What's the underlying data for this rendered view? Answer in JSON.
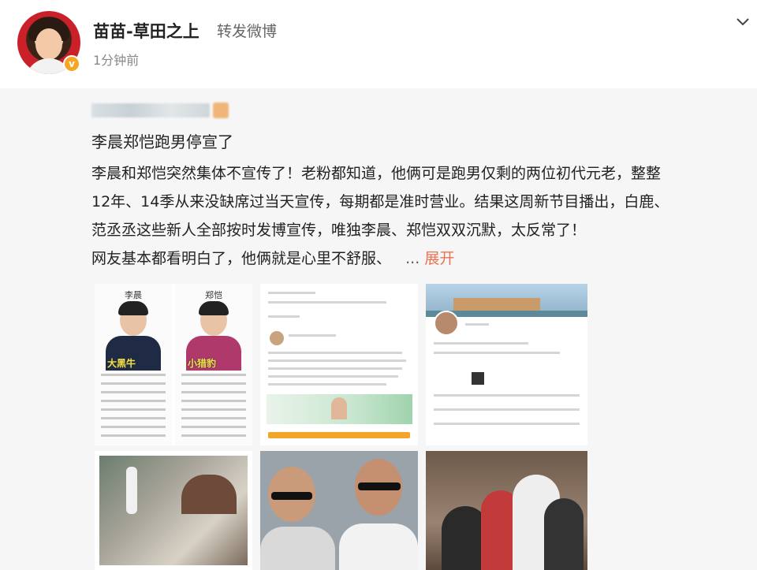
{
  "post": {
    "author_name": "苗苗-草田之上",
    "action": "转发微博",
    "time": "1分钟前"
  },
  "repost": {
    "title": "李晨郑恺跑男停宣了",
    "body_lines": [
      "李晨和郑恺突然集体不宣传了！老粉都知道，他俩可是跑男仅剩的两位初代元老，整整",
      "12年、14季从来没缺席过当天宣传，每期都是准时营业。结果这周新节目播出，白鹿、",
      "范丞丞这些新人全部按时发博宣传，唯独李晨、郑恺双双沉默，太反常了！",
      "网友基本都看明白了，他俩就是心里不舒服、"
    ],
    "ellipsis": "...",
    "expand_label": "展开"
  },
  "images": {
    "profile_left_name": "李晨",
    "profile_left_tag": "大黑牛",
    "profile_right_name": "郑恺",
    "profile_right_tag": "小猎豹"
  },
  "colors": {
    "expand": "#eb7350",
    "card_bg": "#f6f6f6",
    "verified_badge": "#f5a623"
  },
  "icons": {
    "verified": "v-badge-icon",
    "menu": "chevron-down-icon"
  }
}
